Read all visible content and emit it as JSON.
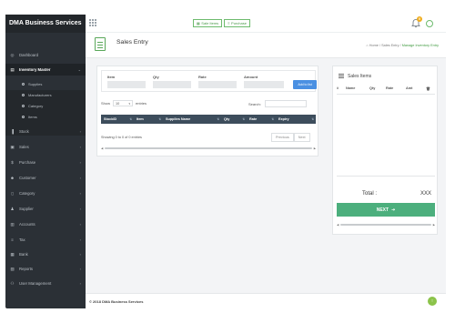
{
  "brand": {
    "name": "DMA Business Services"
  },
  "sidebar": {
    "items": [
      {
        "label": "Dashboard",
        "icon": "dashboard-icon",
        "glyph": "◎",
        "has_chevron": false,
        "active": false
      },
      {
        "label": "Inventory Master",
        "icon": "inventory-icon",
        "glyph": "▤",
        "has_chevron": true,
        "active": true
      },
      {
        "label": "Stock",
        "icon": "stock-icon",
        "glyph": "▐",
        "has_chevron": true,
        "active": false
      },
      {
        "label": "Sales",
        "icon": "sales-icon",
        "glyph": "▣",
        "has_chevron": true,
        "active": false
      },
      {
        "label": "Purchase",
        "icon": "dollar-icon",
        "glyph": "$",
        "has_chevron": true,
        "active": false
      },
      {
        "label": "Customer",
        "icon": "user-icon",
        "glyph": "☻",
        "has_chevron": true,
        "active": false
      },
      {
        "label": "Category",
        "icon": "category-icon",
        "glyph": "▯",
        "has_chevron": true,
        "active": false
      },
      {
        "label": "Supplier",
        "icon": "users-icon",
        "glyph": "♟",
        "has_chevron": true,
        "active": false
      },
      {
        "label": "Accounts",
        "icon": "accounts-icon",
        "glyph": "▥",
        "has_chevron": true,
        "active": false
      },
      {
        "label": "Tax",
        "icon": "tax-icon",
        "glyph": "≡",
        "has_chevron": true,
        "active": false
      },
      {
        "label": "Bank",
        "icon": "bank-icon",
        "glyph": "▦",
        "has_chevron": true,
        "active": false
      },
      {
        "label": "Reports",
        "icon": "reports-icon",
        "glyph": "▧",
        "has_chevron": true,
        "active": false
      },
      {
        "label": "User Management",
        "icon": "user-management-icon",
        "glyph": "⚇",
        "has_chevron": true,
        "active": false
      }
    ],
    "submenu": [
      "Supplies",
      "Manufacturers",
      "Category",
      "Items"
    ]
  },
  "topbar": {
    "buttons": [
      {
        "label": "Sale Items",
        "glyph": "▦"
      },
      {
        "label": "Purchase",
        "glyph": "≡"
      }
    ],
    "notification_count": "0"
  },
  "page": {
    "title": "Sales Entry",
    "breadcrumb": {
      "home": "Home",
      "parent": "Sales Entry",
      "current": "Manage Inventory Entry",
      "sep": "/"
    }
  },
  "form": {
    "fields": [
      {
        "label": "Item",
        "value": ""
      },
      {
        "label": "Qty",
        "value": ""
      },
      {
        "label": "Rate",
        "value": ""
      },
      {
        "label": "Amount",
        "value": ""
      }
    ],
    "add_button": "Add to list"
  },
  "table": {
    "show_label": "Show",
    "entries_value": "10",
    "entries_label": "entries",
    "search_label": "Search:",
    "columns": [
      "StockID",
      "Item",
      "Supplies Name",
      "Qty",
      "Rate",
      "Expiry"
    ],
    "info": "Showing 0 to 0 of 0 entries",
    "previous": "Previous",
    "next": "Next"
  },
  "sales_items": {
    "title": "Sales Items",
    "columns": [
      "#",
      "Name",
      "Qty",
      "Rate",
      "Amt"
    ],
    "total_label": "Total :",
    "total_value": "XXX",
    "next_button": "NEXT"
  },
  "footer": {
    "text": "© 2018 DMA Business Services"
  },
  "colors": {
    "sidebar": "#2b3036",
    "accent_green": "#4caf7d",
    "table_header": "#3d4d5c",
    "add_button": "#4a90e2",
    "badge": "#f0ad1e"
  }
}
